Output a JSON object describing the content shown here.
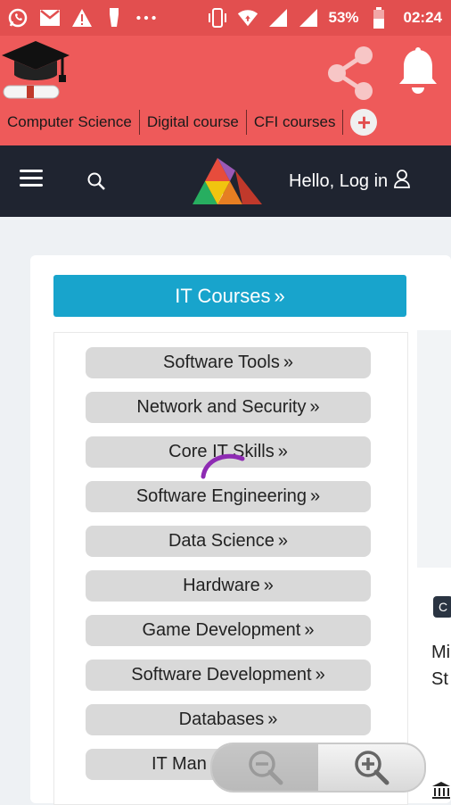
{
  "status_bar": {
    "battery": "53%",
    "time": "02:24",
    "icons": [
      "whatsapp-icon",
      "gmail-icon",
      "warning-icon",
      "usb-icon",
      "more-icon",
      "vibrate-icon",
      "wifi-icon",
      "signal-icon",
      "signal-icon",
      "battery-icon"
    ]
  },
  "app_bar": {
    "categories": [
      "Computer Science",
      "Digital course",
      "CFI courses"
    ],
    "add_label": "+"
  },
  "navbar": {
    "greeting": "Hello, Log in"
  },
  "main": {
    "section_title": "IT Courses",
    "courses": [
      "Software Tools",
      "Network and Security",
      "Core IT Skills",
      "Software Engineering",
      "Data Science",
      "Hardware",
      "Game Development",
      "Software Development",
      "Databases",
      "IT Man"
    ],
    "side_tag": "C",
    "side_lines": [
      "Mi",
      "St"
    ]
  },
  "colors": {
    "app_bar": "#ee5a5a",
    "navbar": "#1f2430",
    "accent": "#18a4cc",
    "spinner": "#8e2bb3"
  }
}
